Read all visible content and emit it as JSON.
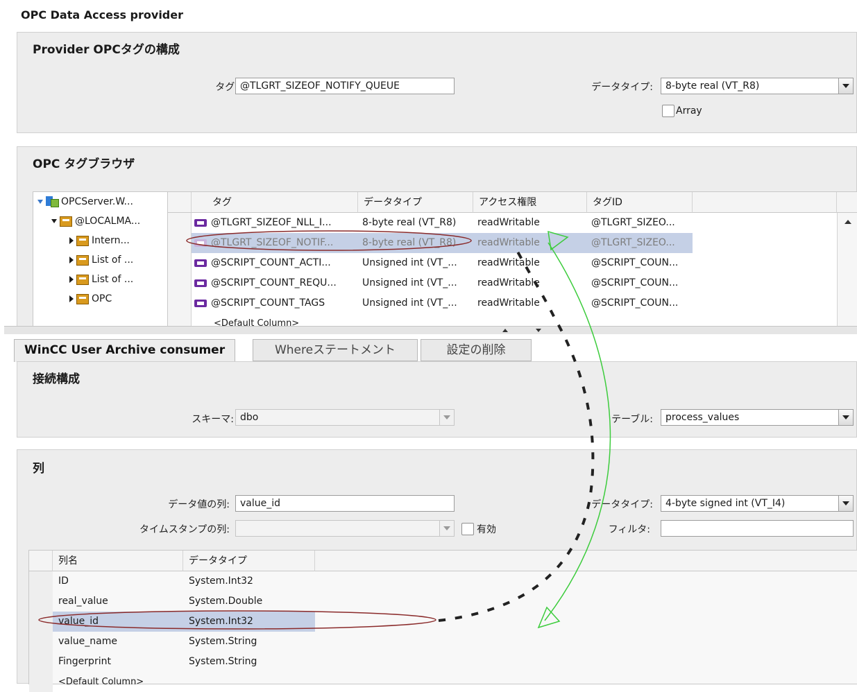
{
  "window_title": "OPC Data Access provider",
  "provider": {
    "header": "Provider OPCタグの構成",
    "tag_label": "タグ:",
    "tag_value": "@TLGRT_SIZEOF_NOTIFY_QUEUE",
    "datatype_label": "データタイプ:",
    "datatype_value": "8-byte real (VT_R8)",
    "array_label": "Array"
  },
  "browser": {
    "header": "OPC タグブラウザ",
    "tree": [
      {
        "label": "OPCServer.W...",
        "level": 0,
        "expanded": true
      },
      {
        "label": "@LOCALMA...",
        "level": 1,
        "expanded": true
      },
      {
        "label": "Intern...",
        "level": 2,
        "expanded": false
      },
      {
        "label": "List of ...",
        "level": 2,
        "expanded": false
      },
      {
        "label": "List of ...",
        "level": 2,
        "expanded": false
      },
      {
        "label": "OPC",
        "level": 2,
        "expanded": false
      }
    ],
    "columns": [
      "タグ",
      "データタイプ",
      "アクセス権限",
      "タグID"
    ],
    "rows": [
      {
        "tag": "@TLGRT_SIZEOF_NLL_I...",
        "type": "8-byte real (VT_R8)",
        "access": "readWritable",
        "id": "@TLGRT_SIZEO..."
      },
      {
        "tag": "@TLGRT_SIZEOF_NOTIF...",
        "type": "8-byte real (VT_R8)",
        "access": "readWritable",
        "id": "@TLGRT_SIZEO...",
        "selected": true
      },
      {
        "tag": "@SCRIPT_COUNT_ACTI...",
        "type": "Unsigned int (VT_...",
        "access": "readWritable",
        "id": "@SCRIPT_COUN..."
      },
      {
        "tag": "@SCRIPT_COUNT_REQU...",
        "type": "Unsigned int (VT_...",
        "access": "readWritable",
        "id": "@SCRIPT_COUN..."
      },
      {
        "tag": "@SCRIPT_COUNT_TAGS",
        "type": "Unsigned int (VT_...",
        "access": "readWritable",
        "id": "@SCRIPT_COUN..."
      }
    ],
    "default_column": "<Default Column>"
  },
  "tabs": [
    "WinCC User Archive consumer",
    "Whereステートメント",
    "設定の削除"
  ],
  "connection": {
    "header": "接続構成",
    "schema_label": "スキーマ:",
    "schema_value": "dbo",
    "table_label": "テーブル:",
    "table_value": "process_values"
  },
  "columns_section": {
    "header": "列",
    "value_col_label": "データ値の列:",
    "value_col_value": "value_id",
    "timestamp_label": "タイムスタンプの列:",
    "timestamp_value": "",
    "valid_label": "有効",
    "datatype_label": "データタイプ:",
    "datatype_value": "4-byte signed int (VT_I4)",
    "filter_label": "フィルタ:",
    "filter_value": "",
    "grid_columns": [
      "列名",
      "データタイプ"
    ],
    "rows": [
      {
        "name": "ID",
        "type": "System.Int32"
      },
      {
        "name": "real_value",
        "type": "System.Double"
      },
      {
        "name": "value_id",
        "type": "System.Int32",
        "selected": true
      },
      {
        "name": "value_name",
        "type": "System.String"
      },
      {
        "name": "Fingerprint",
        "type": "System.String"
      }
    ],
    "default_column": "<Default Column>"
  },
  "colors": {
    "selection": "#c5d0e6",
    "annotation_arrow": "#3ccc3c",
    "annotation_ellipse": "#8a2a2a"
  }
}
